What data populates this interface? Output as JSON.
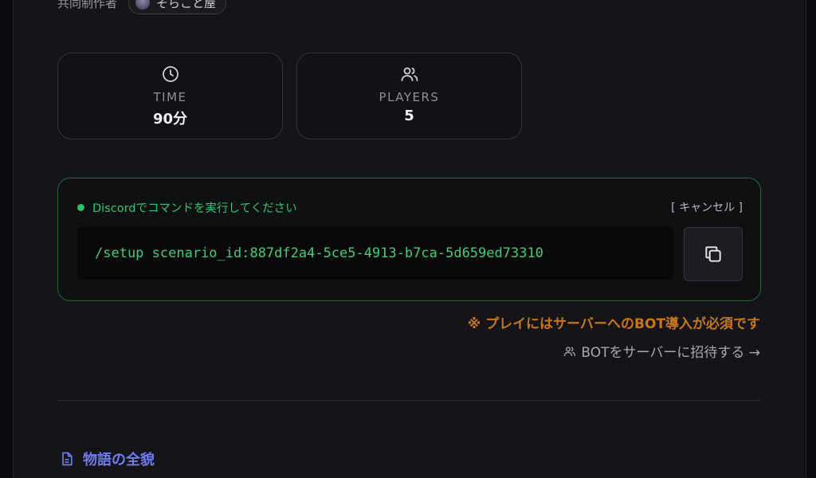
{
  "coauthor": {
    "label": "共同制作者",
    "name": "そらこと屋"
  },
  "stats": [
    {
      "icon": "clock-icon",
      "label": "TIME",
      "value": "90分"
    },
    {
      "icon": "users-icon",
      "label": "PLAYERS",
      "value": "5"
    }
  ],
  "command": {
    "status": "Discordでコマンドを実行してください",
    "cancel_label": "[ キャンセル ]",
    "code": "/setup scenario_id:887df2a4-5ce5-4913-b7ca-5d659ed73310",
    "copy_icon": "copy-icon"
  },
  "notice": "※ プレイにはサーバーへのBOT導入が必須です",
  "invite_link": "BOTをサーバーに招待する →",
  "section": {
    "icon": "document-icon",
    "title": "物語の全貌"
  },
  "colors": {
    "accent_green": "#3ecf74",
    "warning_orange": "#c7761c",
    "section_blue": "#6d7cf0"
  }
}
